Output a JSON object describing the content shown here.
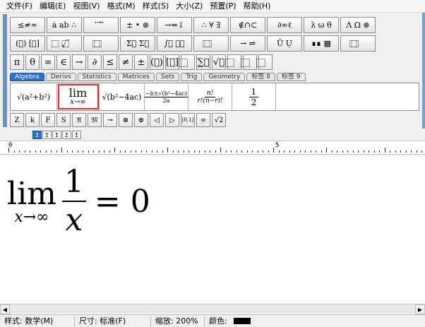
{
  "menubar": [
    "文件(F)",
    "编辑(E)",
    "视图(V)",
    "格式(M)",
    "样式(S)",
    "大小(Z)",
    "预置(P)",
    "帮助(H)"
  ],
  "palette_row1": [
    "≤≠≈",
    "ȧ ab ∴",
    "⃖ ⃗ ⃡",
    "± • ⊗",
    "→⇔↓",
    "∴ ∀ ∃",
    "∉∩⊂",
    "∂∞ℓ",
    "λ ω θ",
    "Λ Ω ⊛"
  ],
  "palette_row2": [
    "(⃞) [⃞]",
    "⃞ √⃞",
    "⃞ ⃞",
    "Σ⃞ Σ⃞",
    "∫⃞ ∮⃞",
    "⃞ ⃞",
    "→ ⇌",
    "Ū Ụ",
    "∎∎ ▦",
    "⃞ ⃞"
  ],
  "palette_row3": [
    "π",
    "θ",
    "∞",
    "∈",
    "→",
    "∂",
    "≤",
    "≠",
    "±",
    "(⃞)",
    "[⃞]",
    "⃞",
    "∑⃞",
    "√⃞",
    "⃞",
    "⃞",
    "⃞"
  ],
  "tabs": [
    "Algebra",
    "Derivs",
    "Statistics",
    "Matrices",
    "Sets",
    "Trig",
    "Geometry",
    "标签 8",
    "标签 9"
  ],
  "templates": [
    {
      "label": "√(a²+b²)"
    },
    {
      "label": "lim",
      "sub": "x→∞"
    },
    {
      "label": "√(b²−4ac)"
    },
    {
      "label": "−b±√(b²−4ac)",
      "den": "2a"
    },
    {
      "label": "n!",
      "den": "r!(n−r)!"
    },
    {
      "label": "1",
      "den": "2"
    }
  ],
  "small_row": [
    "Z",
    "k",
    "F",
    "S",
    "𝔄",
    "𝔐",
    "⊸",
    "⊗",
    "⊕",
    "◁",
    "▷",
    "[0,1]",
    "∞",
    "√2"
  ],
  "size_arrows": [
    "↥",
    "↥",
    "↥",
    "↥",
    "↥"
  ],
  "ruler": {
    "n0": "0",
    "n5": "5"
  },
  "formula": {
    "lim": "lim",
    "sub": "x→∞",
    "num": "1",
    "den": "x",
    "rhs": "= 0"
  },
  "status": {
    "style": "样式: 数学(M)",
    "size": "尺寸: 标准(F)",
    "zoom": "缩放: 200%",
    "color": "颜色:"
  }
}
